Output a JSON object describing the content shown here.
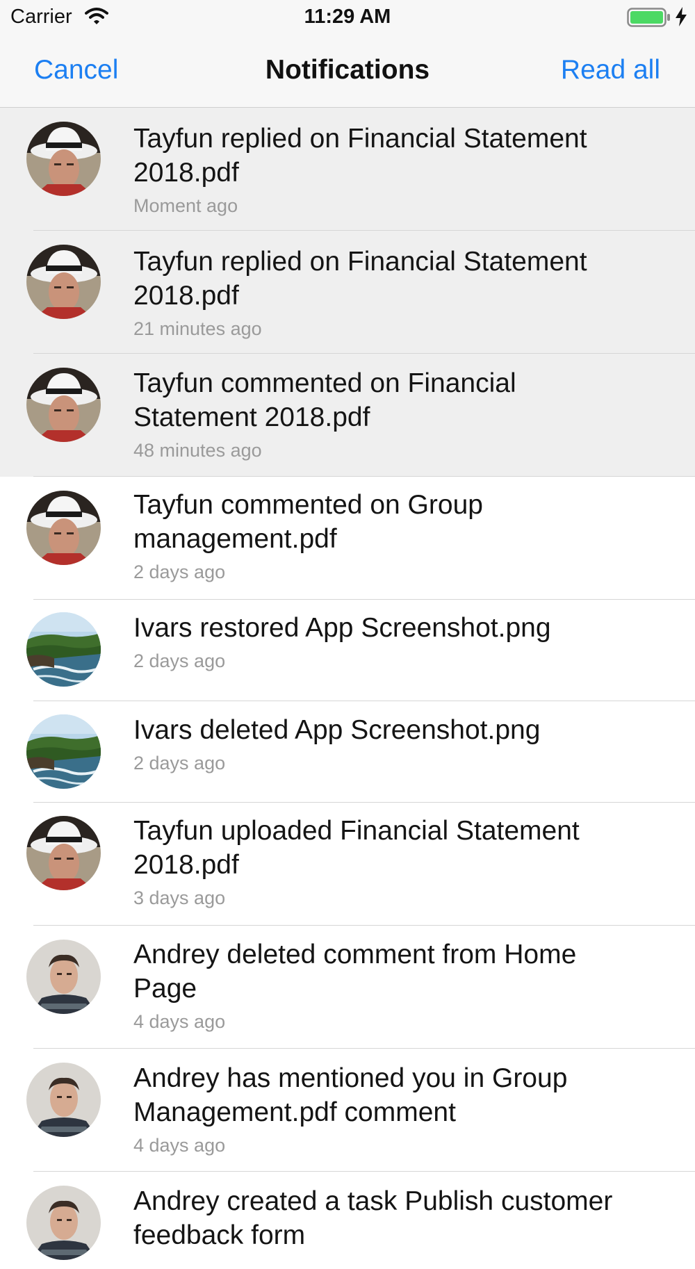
{
  "status_bar": {
    "carrier": "Carrier",
    "time": "11:29 AM"
  },
  "nav": {
    "cancel_label": "Cancel",
    "title": "Notifications",
    "read_all_label": "Read all"
  },
  "colors": {
    "accent": "#1c7ff2",
    "unread_background": "#efefef",
    "battery": "#4cd964"
  },
  "notifications": [
    {
      "avatar": "tayfun-avatar",
      "title": "Tayfun replied on Financial Statement 2018.pdf",
      "time": "Moment ago",
      "unread": true
    },
    {
      "avatar": "tayfun-avatar",
      "title": "Tayfun replied on Financial Statement 2018.pdf",
      "time": "21 minutes ago",
      "unread": true
    },
    {
      "avatar": "tayfun-avatar",
      "title": "Tayfun commented on Financial Statement 2018.pdf",
      "time": "48 minutes ago",
      "unread": true
    },
    {
      "avatar": "tayfun-avatar",
      "title": "Tayfun commented on Group management.pdf",
      "time": "2 days ago",
      "unread": false
    },
    {
      "avatar": "ivars-avatar",
      "title": "Ivars restored App Screenshot.png",
      "time": "2 days ago",
      "unread": false
    },
    {
      "avatar": "ivars-avatar",
      "title": "Ivars deleted App Screenshot.png",
      "time": "2 days ago",
      "unread": false
    },
    {
      "avatar": "tayfun-avatar",
      "title": "Tayfun uploaded Financial Statement 2018.pdf",
      "time": "3 days ago",
      "unread": false
    },
    {
      "avatar": "andrey-avatar",
      "title": "Andrey deleted comment from Home Page",
      "time": "4 days ago",
      "unread": false
    },
    {
      "avatar": "andrey-avatar",
      "title": "Andrey has mentioned you in Group Management.pdf comment",
      "time": "4 days ago",
      "unread": false
    },
    {
      "avatar": "andrey-avatar",
      "title": "Andrey created a task Publish customer feedback form",
      "time": "",
      "unread": false
    }
  ]
}
